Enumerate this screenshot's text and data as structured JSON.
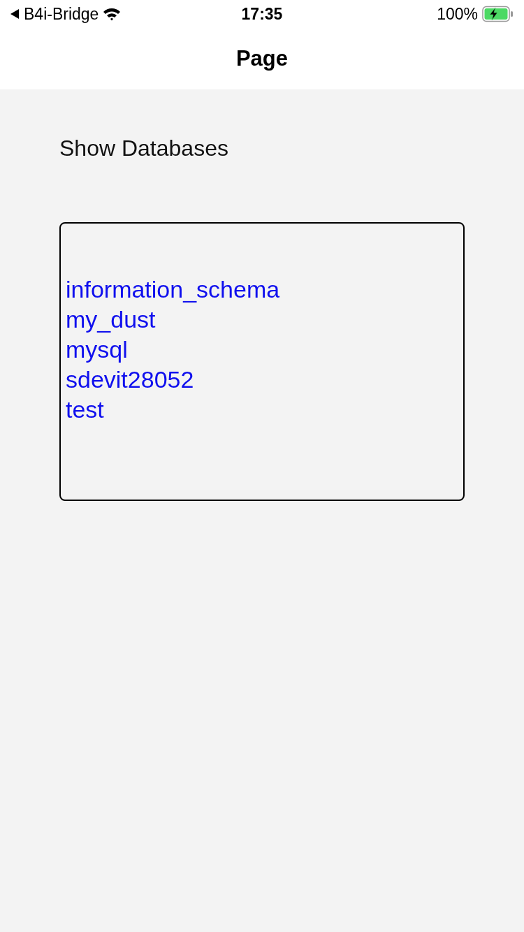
{
  "status_bar": {
    "back_app": "B4i-Bridge",
    "time": "17:35",
    "battery": "100%",
    "charging": true
  },
  "nav_bar": {
    "title": "Page"
  },
  "button": {
    "label": "Show Databases"
  },
  "results": {
    "lines": [
      "information_schema",
      "my_dust",
      "mysql",
      "sdevit28052",
      "test"
    ]
  }
}
